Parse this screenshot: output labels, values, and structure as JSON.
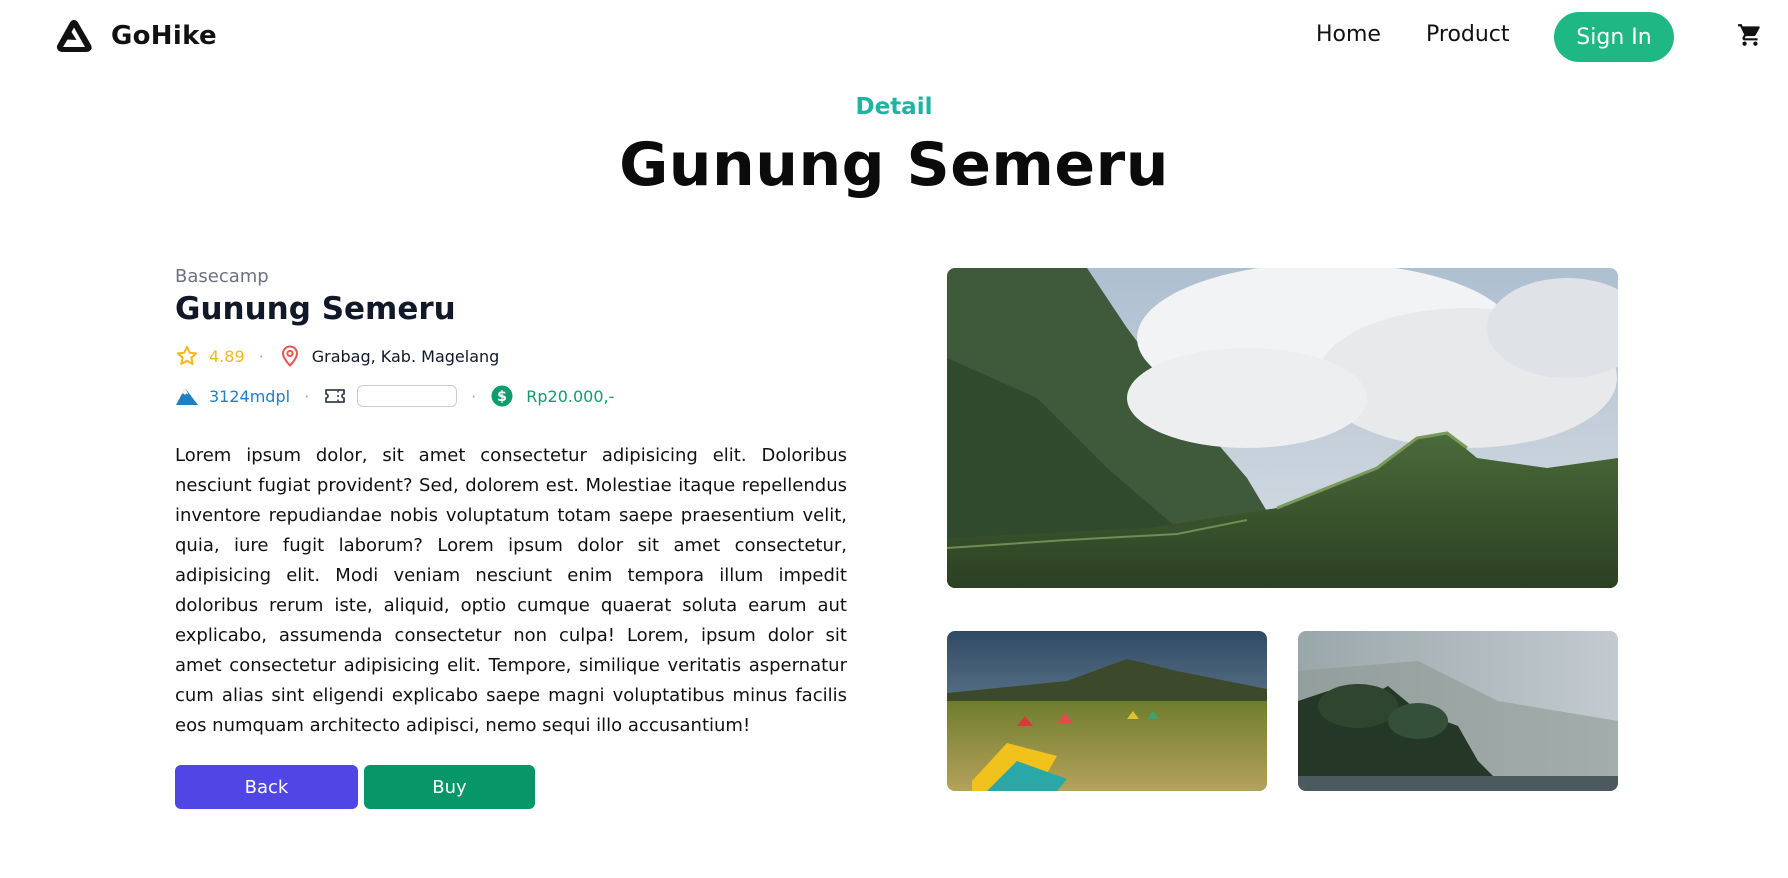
{
  "header": {
    "brand": "GoHike",
    "nav": {
      "home": "Home",
      "product": "Product"
    },
    "signin_label": "Sign In",
    "icons": {
      "logo": "triangle-logo-icon",
      "cart": "cart-icon"
    }
  },
  "hero": {
    "eyebrow": "Detail",
    "title": "Gunung Semeru"
  },
  "detail": {
    "category": "Basecamp",
    "name": "Gunung Semeru",
    "rating": "4.89",
    "location": "Grabag, Kab. Magelang",
    "elevation": "3124mdpl",
    "ticket_value": "",
    "price": "Rp20.000,-",
    "description": "Lorem ipsum dolor, sit amet consectetur adipisicing elit. Doloribus nesciunt fugiat provident? Sed, dolorem est. Molestiae itaque repellendus inventore repudiandae nobis voluptatum totam saepe praesentium velit, quia, iure fugit laborum? Lorem ipsum dolor sit amet consectetur, adipisicing elit. Modi veniam nesciunt enim tempora illum impedit doloribus rerum iste, aliquid, optio cumque quaerat soluta earum aut explicabo, assumenda consectetur non culpa! Lorem, ipsum dolor sit amet consectetur adipisicing elit. Tempore, similique veritatis aspernatur cum alias sint eligendi explicabo saepe magni voluptatibus minus facilis eos numquam architecto adipisci, nemo sequi illo accusantium!",
    "back_label": "Back",
    "buy_label": "Buy",
    "icons": {
      "rating": "star-icon",
      "location": "map-pin-icon",
      "elevation": "mountain-icon",
      "ticket": "ticket-icon",
      "price": "dollar-coin-icon"
    }
  },
  "colors": {
    "brand_green": "#1fb884",
    "eyebrow_teal": "#1fb3a3",
    "rating_yellow": "#f5b81c",
    "back_indigo": "#4f46e5",
    "buy_green": "#069668",
    "elevation_blue": "#1f7fc4"
  }
}
